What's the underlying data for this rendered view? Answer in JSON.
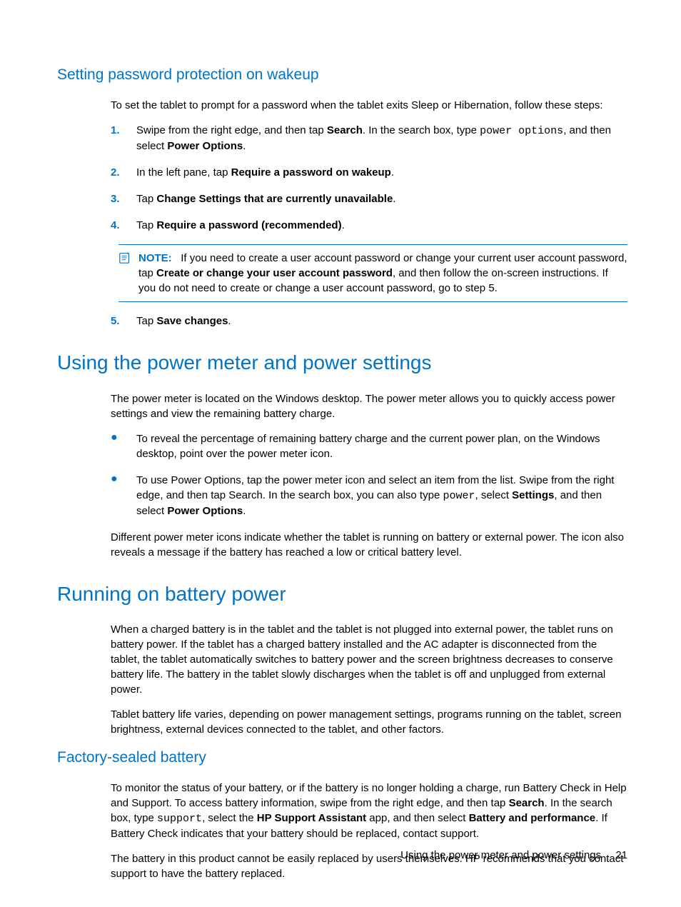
{
  "section1": {
    "heading": "Setting password protection on wakeup",
    "intro": "To set the tablet to prompt for a password when the tablet exits Sleep or Hibernation, follow these steps:",
    "step1_a": "Swipe from the right edge, and then tap ",
    "step1_search": "Search",
    "step1_b": ". In the search box, type ",
    "step1_power_options": "power options",
    "step1_c": ", and then select ",
    "step1_po": "Power Options",
    "step1_d": ".",
    "step2_a": "In the left pane, tap ",
    "step2_b": "Require a password on wakeup",
    "step2_c": ".",
    "step3_a": "Tap ",
    "step3_b": "Change Settings that are currently unavailable",
    "step3_c": ".",
    "step4_a": "Tap ",
    "step4_b": "Require a password (recommended)",
    "step4_c": ".",
    "note_label": "NOTE:",
    "note_a": "If you need to create a user account password or change your current user account password, tap ",
    "note_b": "Create or change your user account password",
    "note_c": ", and then follow the on-screen instructions. If you do not need to create or change a user account password, go to step 5.",
    "step5_a": "Tap ",
    "step5_b": "Save changes",
    "step5_c": "."
  },
  "section2": {
    "heading": "Using the power meter and power settings",
    "intro": "The power meter is located on the Windows desktop. The power meter allows you to quickly access power settings and view the remaining battery charge.",
    "bullet1": "To reveal the percentage of remaining battery charge and the current power plan, on the Windows desktop, point over the power meter icon.",
    "bullet2_a": "To use Power Options, tap the power meter icon and select an item from the list. Swipe from the right edge, and then tap Search. In the search box, you can also type ",
    "bullet2_power": "power",
    "bullet2_b": ", select ",
    "bullet2_settings": "Settings",
    "bullet2_c": ", and then select ",
    "bullet2_po": "Power Options",
    "bullet2_d": ".",
    "closing": "Different power meter icons indicate whether the tablet is running on battery or external power. The icon also reveals a message if the battery has reached a low or critical battery level."
  },
  "section3": {
    "heading": "Running on battery power",
    "p1": "When a charged battery is in the tablet and the tablet is not plugged into external power, the tablet runs on battery power. If the tablet has a charged battery installed and the AC adapter is disconnected from the tablet, the tablet automatically switches to battery power and the screen brightness decreases to conserve battery life. The battery in the tablet slowly discharges when the tablet is off and unplugged from external power.",
    "p2": "Tablet battery life varies, depending on power management settings, programs running on the tablet, screen brightness, external devices connected to the tablet, and other factors.",
    "sub_heading": "Factory-sealed battery",
    "p3_a": "To monitor the status of your battery, or if the battery is no longer holding a charge, run Battery Check in Help and Support. To access battery information, swipe from the right edge, and then tap ",
    "p3_search": "Search",
    "p3_b": ". In the search box, type ",
    "p3_support": "support",
    "p3_c": ", select the ",
    "p3_hpsa": "HP Support Assistant",
    "p3_d": " app, and then select ",
    "p3_bp": "Battery and performance",
    "p3_e": ". If Battery Check indicates that your battery should be replaced, contact support.",
    "p4": "The battery in this product cannot be easily replaced by users themselves. HP recommends that you contact support to have the battery replaced."
  },
  "footer": {
    "text": "Using the power meter and power settings",
    "page": "21"
  },
  "numbers": {
    "n1": "1.",
    "n2": "2.",
    "n3": "3.",
    "n4": "4.",
    "n5": "5."
  },
  "bullet": "●"
}
